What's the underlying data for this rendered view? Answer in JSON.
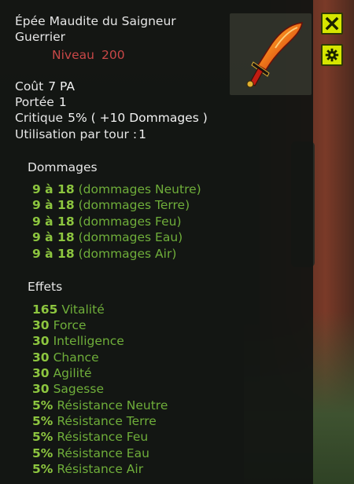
{
  "item": {
    "name": "Épée Maudite du Saigneur",
    "type": "Guerrier",
    "level_label": "Niveau",
    "level_value": "200"
  },
  "stats": [
    {
      "label": "Coût",
      "value": "7 PA"
    },
    {
      "label": "Portée",
      "value": "1"
    },
    {
      "label": "Critique",
      "value": "5% ( +10 Dommages )"
    },
    {
      "label": "Utilisation par tour :",
      "value": "1"
    }
  ],
  "damages": {
    "title": "Dommages",
    "lines": [
      {
        "num": "9 à 18",
        "text": "(dommages Neutre)"
      },
      {
        "num": "9 à 18",
        "text": "(dommages Terre)"
      },
      {
        "num": "9 à 18",
        "text": "(dommages Feu)"
      },
      {
        "num": "9 à 18",
        "text": "(dommages Eau)"
      },
      {
        "num": "9 à 18",
        "text": "(dommages Air)"
      }
    ]
  },
  "effects": {
    "title": "Effets",
    "lines": [
      {
        "num": "165",
        "text": "Vitalité"
      },
      {
        "num": "30",
        "text": "Force"
      },
      {
        "num": "30",
        "text": "Intelligence"
      },
      {
        "num": "30",
        "text": "Chance"
      },
      {
        "num": "30",
        "text": "Agilité"
      },
      {
        "num": "30",
        "text": "Sagesse"
      },
      {
        "num": "5%",
        "text": "Résistance Neutre"
      },
      {
        "num": "5%",
        "text": "Résistance Terre"
      },
      {
        "num": "5%",
        "text": "Résistance Feu"
      },
      {
        "num": "5%",
        "text": "Résistance Eau"
      },
      {
        "num": "5%",
        "text": "Résistance Air"
      }
    ]
  },
  "buttons": {
    "close_icon": "close-icon",
    "settings_icon": "gear-icon"
  },
  "colors": {
    "level": "#c84747",
    "bonus_number": "#8dc63f",
    "bonus_text": "#6fae3a",
    "button_bg": "#d6e600"
  }
}
